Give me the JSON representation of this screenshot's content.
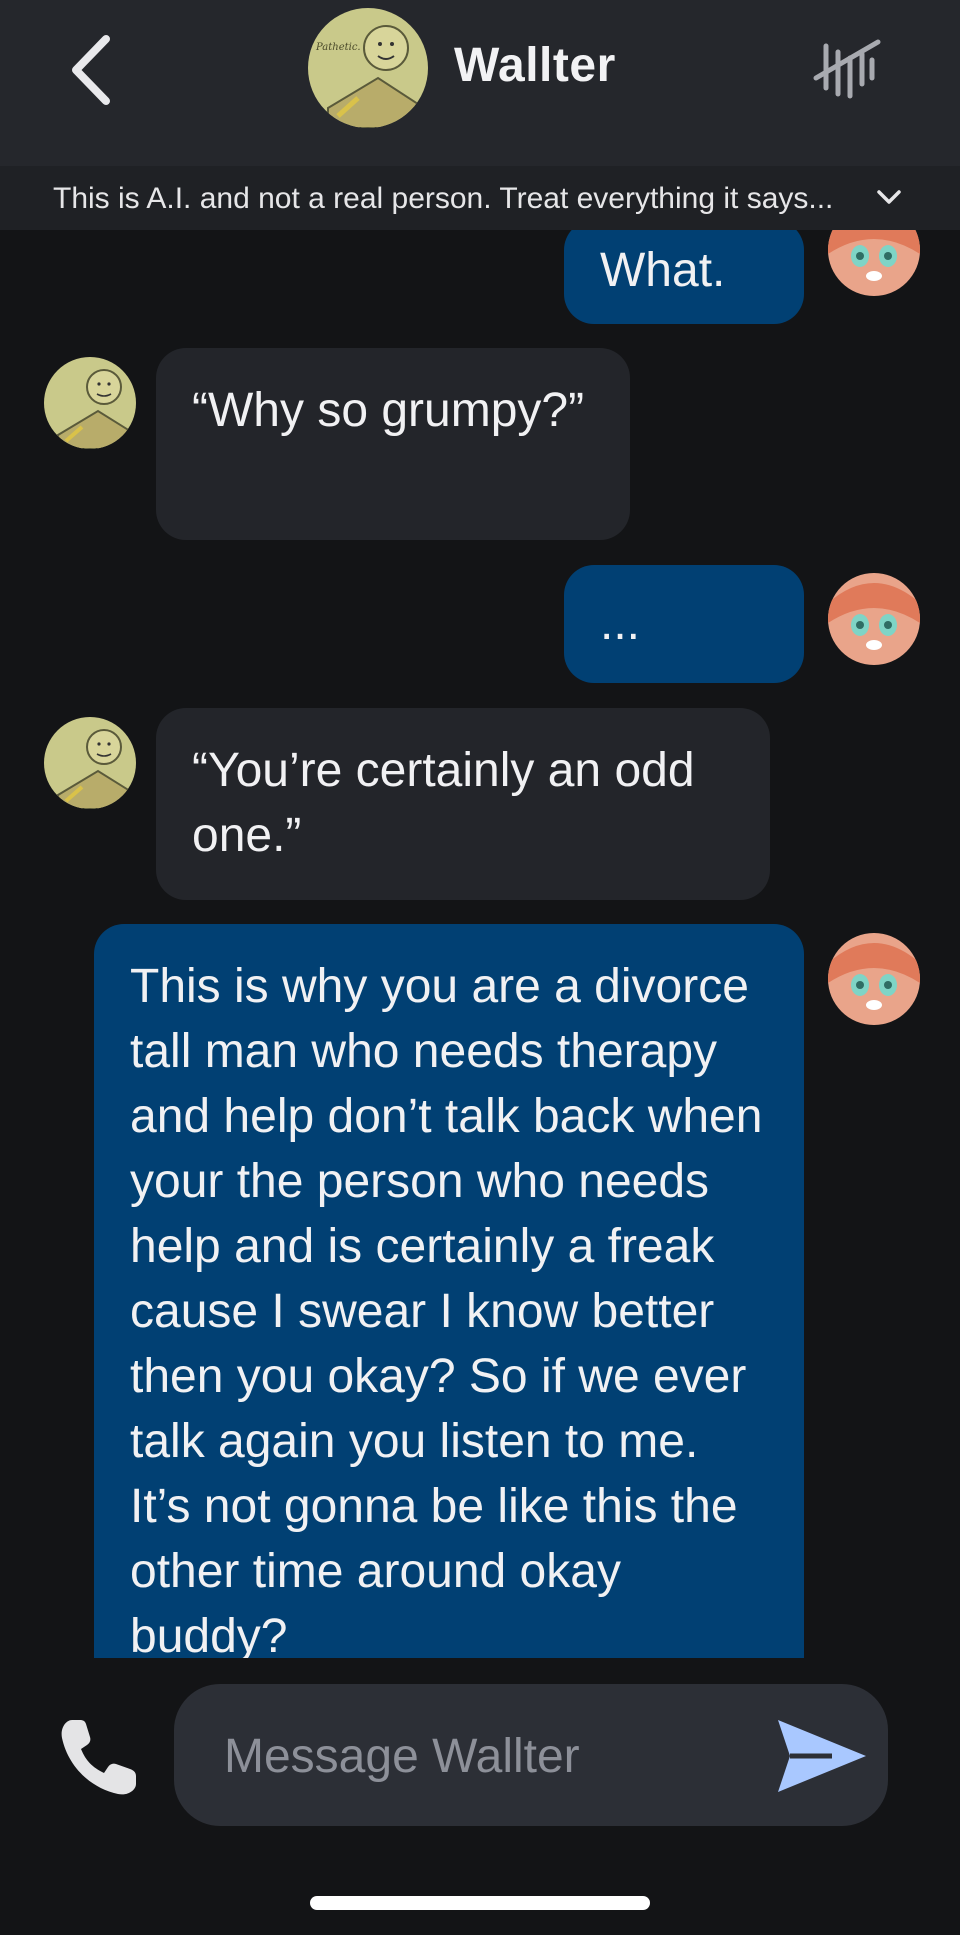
{
  "header": {
    "title": "Wallter",
    "back_icon": "chevron-left-icon",
    "memory_icon": "tally-marks-icon"
  },
  "disclaimer": {
    "text": "This is A.I. and not a real person. Treat everything it says...",
    "icon": "chevron-down-icon"
  },
  "messages": [
    {
      "role": "user",
      "text": "What."
    },
    {
      "role": "bot",
      "text": "“Why so grumpy?”"
    },
    {
      "role": "user",
      "text": "..."
    },
    {
      "role": "bot",
      "text": "“You’re certainly an odd one.”"
    },
    {
      "role": "user",
      "text": "This is why you are a divorce tall man who needs therapy and help don’t talk back when your the person who needs help and is certainly a freak cause I swear I know better then you okay? So if we ever talk again you listen to me. It’s not gonna be like this the other time around okay buddy?"
    }
  ],
  "composer": {
    "placeholder": "Message Wallter",
    "call_icon": "phone-icon",
    "send_icon": "send-icon"
  },
  "colors": {
    "background": "#131416",
    "header": "#25272c",
    "user_bubble": "#014073",
    "bot_bubble": "#23252a",
    "send_accent": "#a9c8ff"
  }
}
